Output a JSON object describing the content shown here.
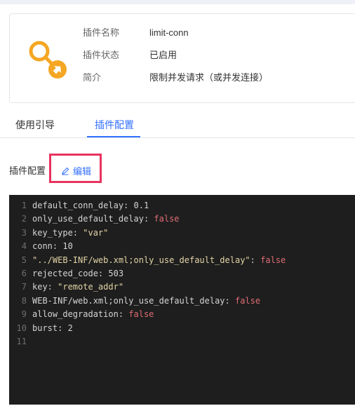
{
  "plugin": {
    "name_label": "插件名称",
    "name_value": "limit-conn",
    "status_label": "插件状态",
    "status_value": "已启用",
    "desc_label": "简介",
    "desc_value": "限制并发请求（或并发连接）",
    "icon": "key-plug-icon"
  },
  "tabs": [
    {
      "label": "使用引导",
      "active": false
    },
    {
      "label": "插件配置",
      "active": true
    }
  ],
  "config": {
    "section_title": "插件配置",
    "edit_label": "编辑",
    "edit_icon": "pencil-icon"
  },
  "editor": {
    "lines": [
      {
        "num": "1",
        "parts": [
          {
            "t": "default_conn_delay: 0.1",
            "c": ""
          }
        ]
      },
      {
        "num": "2",
        "parts": [
          {
            "t": "only_use_default_delay: ",
            "c": ""
          },
          {
            "t": "false",
            "c": "false"
          }
        ]
      },
      {
        "num": "3",
        "parts": [
          {
            "t": "key_type: ",
            "c": ""
          },
          {
            "t": "\"var\"",
            "c": "str"
          }
        ]
      },
      {
        "num": "4",
        "parts": [
          {
            "t": "conn: 10",
            "c": ""
          }
        ]
      },
      {
        "num": "5",
        "parts": [
          {
            "t": "\"../WEB-INF/web.xml;only_use_default_delay\"",
            "c": "str"
          },
          {
            "t": ": ",
            "c": ""
          },
          {
            "t": "false",
            "c": "false"
          }
        ]
      },
      {
        "num": "6",
        "parts": [
          {
            "t": "rejected_code: 503",
            "c": ""
          }
        ]
      },
      {
        "num": "7",
        "parts": [
          {
            "t": "key: ",
            "c": ""
          },
          {
            "t": "\"remote_addr\"",
            "c": "str"
          }
        ]
      },
      {
        "num": "8",
        "parts": [
          {
            "t": "WEB-INF/web.xml;only_use_default_delay: ",
            "c": ""
          },
          {
            "t": "false",
            "c": "false"
          }
        ]
      },
      {
        "num": "9",
        "parts": [
          {
            "t": "allow_degradation: ",
            "c": ""
          },
          {
            "t": "false",
            "c": "false"
          }
        ]
      },
      {
        "num": "10",
        "parts": [
          {
            "t": "burst: 2",
            "c": ""
          }
        ]
      },
      {
        "num": "11",
        "parts": []
      }
    ]
  },
  "colors": {
    "accent": "#3370ff",
    "highlight_border": "#e8335f",
    "editor_bg": "#1e1e1e",
    "keyword_false": "#e06c75",
    "string": "#e2d4a6",
    "icon_orange": "#f5a623"
  }
}
